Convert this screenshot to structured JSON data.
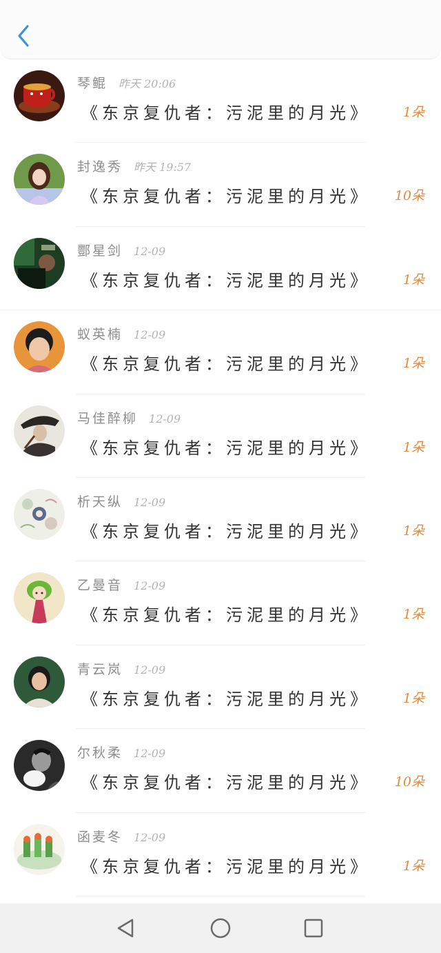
{
  "colors": {
    "accent_blue": "#3a93d4",
    "gift_orange": "#e58a3d",
    "name_gray": "#8d8d8d",
    "title_dark": "#333333"
  },
  "header": {
    "back_icon": "chevron-left-icon"
  },
  "items": [
    {
      "name": "琴鲲",
      "time": "昨天 20:06",
      "title": "《东京复仇者：污泥里的月光》",
      "gift": "1朵",
      "avatar": "tea-cup"
    },
    {
      "name": "封逸秀",
      "time": "昨天 19:57",
      "title": "《东京复仇者：污泥里的月光》",
      "gift": "10朵",
      "avatar": "girl-portrait"
    },
    {
      "name": "酆星剑",
      "time": "12-09",
      "title": "《东京复仇者：污泥里的月光》",
      "gift": "1朵",
      "avatar": "dark-green-photo"
    },
    {
      "name": "蚁英楠",
      "time": "12-09",
      "title": "《东京复仇者：污泥里的月光》",
      "gift": "1朵",
      "avatar": "boy-orange"
    },
    {
      "name": "马佳醉柳",
      "time": "12-09",
      "title": "《东京复仇者：污泥里的月光》",
      "gift": "1朵",
      "avatar": "hat-man"
    },
    {
      "name": "析天纵",
      "time": "12-09",
      "title": "《东京复仇者：污泥里的月光》",
      "gift": "1朵",
      "avatar": "floral-art"
    },
    {
      "name": "乙曼音",
      "time": "12-09",
      "title": "《东京复仇者：污泥里的月光》",
      "gift": "1朵",
      "avatar": "cartoon-girl"
    },
    {
      "name": "青云岚",
      "time": "12-09",
      "title": "《东京复仇者：污泥里的月光》",
      "gift": "1朵",
      "avatar": "woman-green"
    },
    {
      "name": "尔秋柔",
      "time": "12-09",
      "title": "《东京复仇者：污泥里的月光》",
      "gift": "10朵",
      "avatar": "bw-photo"
    },
    {
      "name": "函麦冬",
      "time": "12-09",
      "title": "《东京复仇者：污泥里的月光》",
      "gift": "1朵",
      "avatar": "food-plate"
    }
  ],
  "navbar": {
    "back_icon": "triangle-back-icon",
    "home_icon": "circle-home-icon",
    "recent_icon": "square-recent-icon"
  }
}
